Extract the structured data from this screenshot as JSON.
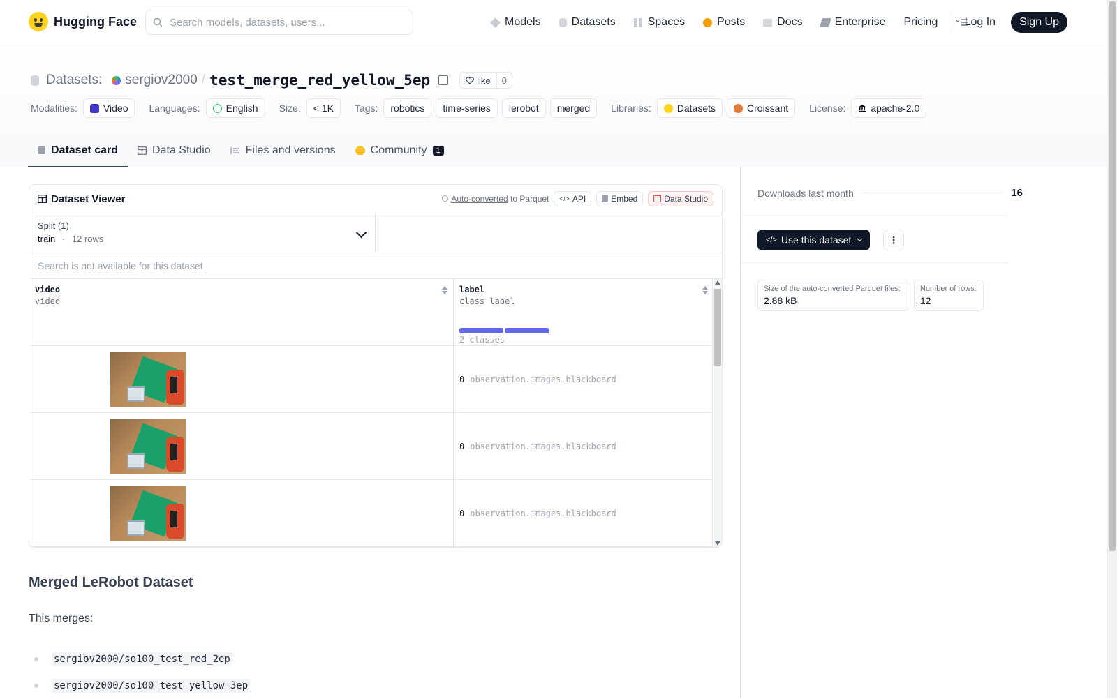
{
  "nav": {
    "brand": "Hugging Face",
    "search_placeholder": "Search models, datasets, users...",
    "links": [
      "Models",
      "Datasets",
      "Spaces",
      "Posts",
      "Docs",
      "Enterprise",
      "Pricing"
    ],
    "login": "Log In",
    "signup": "Sign Up"
  },
  "header": {
    "section": "Datasets:",
    "user": "sergiov2000",
    "sep": "/",
    "repo": "test_merge_red_yellow_5ep",
    "like_label": "like",
    "like_count": "0",
    "modalities_key": "Modalities:",
    "modality": "Video",
    "languages_key": "Languages:",
    "language": "English",
    "size_key": "Size:",
    "size": "< 1K",
    "tags_key": "Tags:",
    "tags": [
      "robotics",
      "time-series",
      "lerobot",
      "merged"
    ],
    "libraries_key": "Libraries:",
    "libraries": [
      "Datasets",
      "Croissant"
    ],
    "license_key": "License:",
    "license": "apache-2.0"
  },
  "tabs": [
    {
      "label": "Dataset card"
    },
    {
      "label": "Data Studio"
    },
    {
      "label": "Files and versions"
    },
    {
      "label": "Community",
      "badge": "1"
    }
  ],
  "viewer": {
    "title": "Dataset Viewer",
    "auto_converted": "Auto-converted",
    "to_parquet": "to Parquet",
    "api": "API",
    "embed": "Embed",
    "data_studio": "Data Studio",
    "split_label": "Split (1)",
    "split_name": "train",
    "split_dot": "·",
    "split_rows": "12 rows",
    "search_na": "Search is not available for this dataset",
    "columns": [
      {
        "name": "video",
        "type": "video"
      },
      {
        "name": "label",
        "type": "class label",
        "classes": "2 classes"
      }
    ],
    "rows": [
      {
        "label_num": "0",
        "label_text": "observation.images.blackboard"
      },
      {
        "label_num": "0",
        "label_text": "observation.images.blackboard"
      },
      {
        "label_num": "0",
        "label_text": "observation.images.blackboard"
      }
    ]
  },
  "card": {
    "heading": "Merged LeRobot Dataset",
    "intro": "This merges:",
    "items": [
      "sergiov2000/so100_test_red_2ep",
      "sergiov2000/so100_test_yellow_3ep"
    ]
  },
  "sidebar": {
    "downloads_label": "Downloads last month",
    "downloads": "16",
    "use_button": "Use this dataset",
    "parquet_label": "Size of the auto-converted Parquet files:",
    "parquet_size": "2.88 kB",
    "rows_label": "Number of rows:",
    "rows": "12"
  },
  "colors": {
    "accent_dark": "#111827",
    "class_bar": "#6366f1",
    "community_icon": "#fbbf24"
  }
}
